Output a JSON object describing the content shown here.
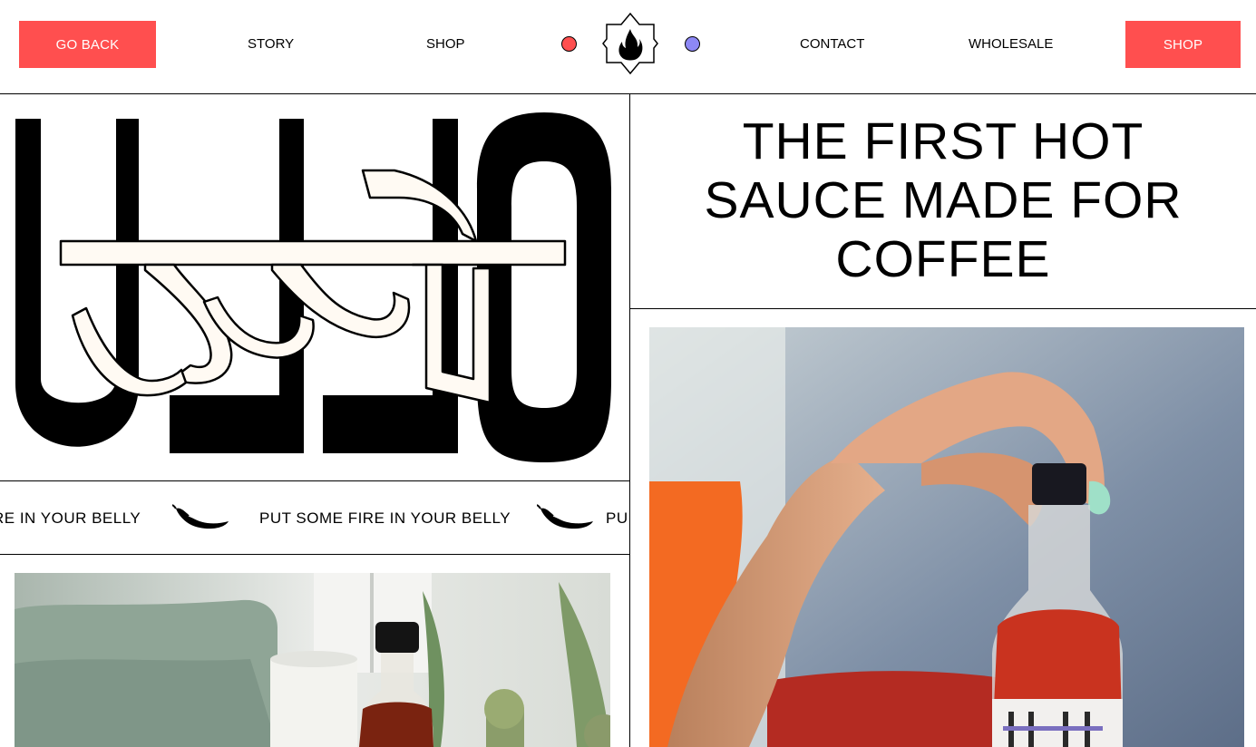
{
  "header": {
    "go_back_label": "GO BACK",
    "nav": {
      "story": "STORY",
      "shop": "SHOP",
      "contact": "CONTACT",
      "wholesale": "WHOLESALE"
    },
    "shop_button_label": "SHOP",
    "logo_icon": "flame-star-icon"
  },
  "hero": {
    "headline_line1": "THE FIRST HOT",
    "headline_line2": "SAUCE MADE FOR",
    "headline_line3": "COFFEE",
    "brand_logo_text": "UJJO",
    "brand_logo_devanagari": "उज्जो"
  },
  "marquee": {
    "text_partial_start": "RE IN YOUR BELLY",
    "text_full": "PUT SOME FIRE IN YOUR BELLY",
    "text_partial_end": "PU",
    "icon": "chili-pepper-icon"
  },
  "colors": {
    "accent_red": "#ff4f4f",
    "accent_blue": "#8d88f5",
    "line": "#000000",
    "background": "#ffffff"
  }
}
